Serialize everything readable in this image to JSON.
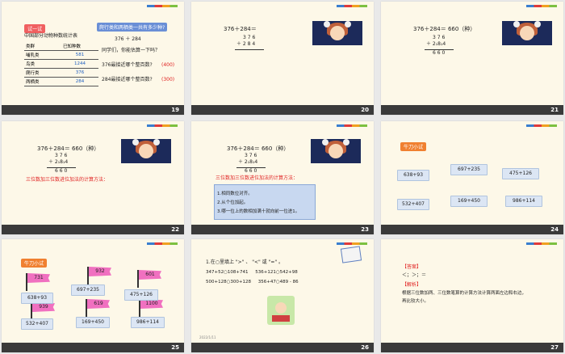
{
  "slides": [
    {
      "num": "19",
      "tag": "试一试",
      "table_title": "中国部分动物种数统计表",
      "header": [
        "类群",
        "已知种数"
      ],
      "rows": [
        [
          "哺乳类",
          "581"
        ],
        [
          "鸟类",
          "1244"
        ],
        [
          "爬行类",
          "376"
        ],
        [
          "两栖类",
          "284"
        ]
      ],
      "question": "爬行类和两栖类一共有多少种?",
      "expr": "376 ＋ 284",
      "estimate": "同学们，你能估算一下吗？",
      "q1": "376最接近哪个整百数?",
      "a1": "(400)",
      "q2": "284最接近哪个整百数?",
      "a2": "(300)"
    },
    {
      "num": "20",
      "expr": "376＋284＝",
      "top": "3 7 6",
      "bottom": "＋ 2 8 4"
    },
    {
      "num": "21",
      "expr": "376＋284＝ 660（种）",
      "top": "3 7 6",
      "bottom": "＋ 2₁8₁4",
      "result": "6 6 0"
    },
    {
      "num": "22",
      "expr": "376＋284＝ 660（种）",
      "top": "3 7 6",
      "bottom": "＋ 2₁8₁4",
      "result": "6 6 0",
      "method": "三位数加三位数进位加法的计算方法："
    },
    {
      "num": "23",
      "expr": "376＋284＝ 660（种）",
      "top": "3 7 6",
      "bottom": "＋ 2₁8₁4",
      "result": "6 6 0",
      "method": "三位数加三位数进位加法的计算方法：",
      "steps": [
        "1.相同数位对齐。",
        "2.从个位加起。",
        "3.哪一位上的数相加满十就向前一位进1。"
      ]
    },
    {
      "num": "24",
      "tag": "牛刀小试",
      "items": [
        "638+93",
        "697+235",
        "475+126",
        "532+407",
        "169+450",
        "986+114"
      ]
    },
    {
      "num": "25",
      "tag": "牛刀小试",
      "flags": [
        "731",
        "932",
        "601",
        "939",
        "619",
        "1100"
      ],
      "items": [
        "638+93",
        "697+235",
        "475+126",
        "532+407",
        "169+450",
        "986+114"
      ]
    },
    {
      "num": "26",
      "title": "1.在○里填上 \">\" 、 \"<\" 或 \"=\" 。",
      "row1": "347+52○108+741     536+121○542+98",
      "row2": "500+128○300+128     356+47○489 - 86",
      "date": "2022/1/11"
    },
    {
      "num": "27",
      "answer_tag": "【答案】",
      "answer": "＜；＞；＝",
      "analysis_tag": "【解析】",
      "analysis1": "根据三位数加两、三位数笔算的计算方法计算两面左边和右边，",
      "analysis2": "再比较大小。"
    }
  ]
}
